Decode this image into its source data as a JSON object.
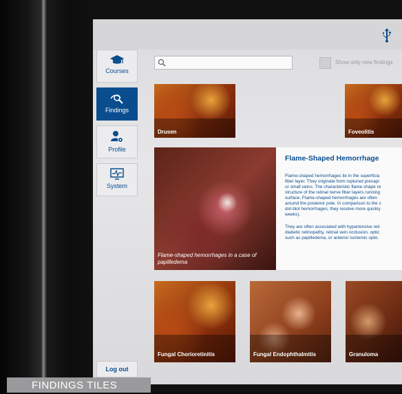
{
  "sidebar": {
    "items": [
      {
        "label": "Courses",
        "icon": "graduation-cap-icon",
        "active": false
      },
      {
        "label": "Findings",
        "icon": "eye-search-icon",
        "active": true
      },
      {
        "label": "Profile",
        "icon": "user-gear-icon",
        "active": false
      },
      {
        "label": "System",
        "icon": "monitor-pulse-icon",
        "active": false
      }
    ],
    "logout_label": "Log out"
  },
  "topbar": {
    "usb_icon": "usb-icon"
  },
  "search": {
    "placeholder": "",
    "value": ""
  },
  "filter": {
    "label": "Show only new findings",
    "checked": false
  },
  "tiles": {
    "row1": [
      {
        "label": "Drusen"
      },
      {
        "label": "Foveolitis"
      }
    ],
    "row3": [
      {
        "label": "Fungal Chorioretinitis"
      },
      {
        "label": "Fungal Endophthalmitis"
      },
      {
        "label": "Granuloma"
      }
    ]
  },
  "detail": {
    "title": "Flame-Shaped Hemorrhage",
    "image_caption": "Flame-shaped hemorrhages in a case of papilledema",
    "paragraph1_lines": [
      "Flame-shaped hemorrhages lie in the superficia",
      "fiber layer. They originate from ruptured precapi",
      "or small veins. The characteristic flame shape re",
      "structure of the retinal nerve fiber layers running",
      "surface. Flame-shaped hemorrhages are often",
      "around the posterior pole. In comparison to the c",
      "dot-blot hemorrhages, they resolve more quickly",
      "weeks)."
    ],
    "paragraph2_lines": [
      "They are often associated with hypertensive reti",
      "diabetic retinopathy, retinal vein occlusion, optic",
      "such as papilledema, or anterior ischemic optic"
    ]
  },
  "caption_bar": {
    "label": "FINDINGS TILES"
  },
  "colors": {
    "accent": "#0a4d8e",
    "background": "#e3e3e5"
  }
}
